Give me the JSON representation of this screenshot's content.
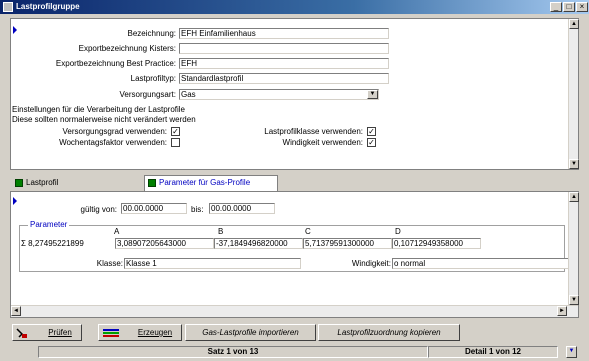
{
  "window": {
    "title": "Lastprofilgruppe",
    "controls": {
      "minimize": "_",
      "maximize": "□",
      "close": "×"
    }
  },
  "upper": {
    "fields": [
      {
        "label": "Bezeichnung:",
        "value": "EFH Einfamilienhaus"
      },
      {
        "label": "Exportbezeichnung Kisters:",
        "value": ""
      },
      {
        "label": "Exportbezeichnung Best Practice:",
        "value": "EFH"
      },
      {
        "label": "Lastprofiltyp:",
        "value": "Standardlastprofil"
      },
      {
        "label": "Versorgungsart:",
        "value": "Gas"
      }
    ],
    "info_line1": "Einstellungen für die Verarbeitung der Lastprofile",
    "info_line2": "Diese sollten normalerweise nicht verändert werden",
    "checks": [
      {
        "label": "Versorgungsgrad verwenden:",
        "checked": true
      },
      {
        "label": "Lastprofilklasse verwenden:",
        "checked": true
      },
      {
        "label": "Wochentagsfaktor verwenden:",
        "checked": false
      },
      {
        "label": "Windigkeit verwenden:",
        "checked": true
      }
    ]
  },
  "tabs": [
    {
      "label": "Lastprofil",
      "active": false
    },
    {
      "label": "Parameter für Gas-Profile",
      "active": true
    }
  ],
  "lower": {
    "gueltig_von_label": "gültig von:",
    "gueltig_von_value": "00.00.0000",
    "bis_label": "bis:",
    "bis_value": "00.00.0000",
    "group_title": "Parameter",
    "sigma_label": "Σ 8,27495221899",
    "columns": [
      "A",
      "B",
      "C",
      "D"
    ],
    "values": [
      "3,08907205643000",
      "-37,1849496820000",
      "5,71379591300000",
      "0,10712949358000"
    ],
    "klasse_label": "Klasse:",
    "klasse_value": "Klasse 1",
    "windigkeit_label": "Windigkeit:",
    "windigkeit_value": "o normal"
  },
  "buttons": {
    "pruefen": "Prüfen",
    "erzeugen": "Erzeugen",
    "import": "Gas-Lastprofile importieren",
    "copy": "Lastprofilzuordnung kopieren"
  },
  "status": {
    "satz": "Satz 1 von 13",
    "detail": "Detail 1 von 12"
  }
}
